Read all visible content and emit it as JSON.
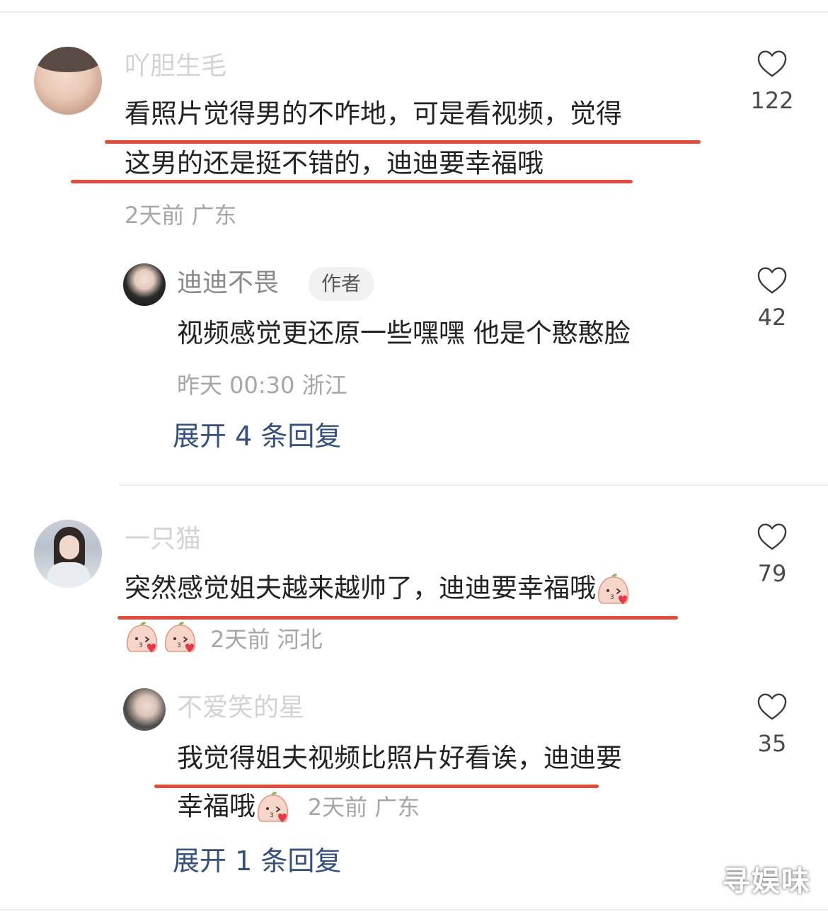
{
  "comments": [
    {
      "username": "吖胆生毛",
      "text_line1": "看照片觉得男的不咋地，可是看视频，觉得",
      "text_line2": "这男的还是挺不错的，迪迪要幸福哦",
      "meta": "2天前 广东",
      "likes": "122",
      "reply": {
        "username": "迪迪不畏",
        "badge": "作者",
        "text": "视频感觉更还原一些嘿嘿 他是个憨憨脸",
        "meta": "昨天 00:30 浙江",
        "likes": "42"
      },
      "expand_label": "展开 4 条回复"
    },
    {
      "username": "一只猫",
      "text_line1": "突然感觉姐夫越来越帅了，迪迪要幸福哦",
      "meta": "2天前 河北",
      "likes": "79",
      "reply": {
        "username": "不爱笑的星",
        "text_line1": "我觉得姐夫视频比照片好看诶，迪迪要",
        "text_line2": "幸福哦",
        "meta": "2天前 广东",
        "likes": "35"
      },
      "expand_label": "展开 1 条回复"
    }
  ],
  "watermark": "寻娱味",
  "colors": {
    "underline": "#e24a3b",
    "expand_link": "#34507f",
    "meta_text": "#a6a6a6"
  }
}
